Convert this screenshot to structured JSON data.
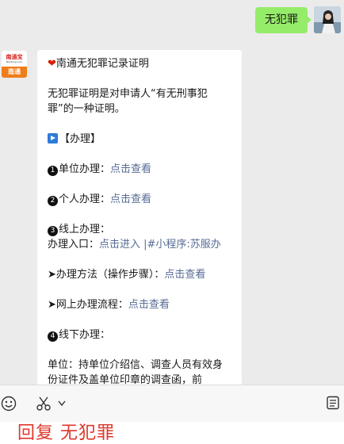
{
  "outgoing": {
    "text": "无犯罪"
  },
  "incoming": {
    "avatar": {
      "logo_text": "南通宝",
      "logo_sub": "Nantong.com",
      "tag": "南通"
    },
    "title_icon": "❤",
    "title": "南通无犯罪记录证明",
    "intro": "无犯罪证明是对申请人“有无刑事犯罪”的一种证明。",
    "handle_label": "【办理】",
    "items": {
      "unit": {
        "num": "1",
        "label": "单位办理：",
        "link": "点击查看"
      },
      "personal": {
        "num": "2",
        "label": "个人办理：",
        "link": "点击查看"
      },
      "online": {
        "num": "3",
        "label": "线上办理：",
        "entry_label": "办理入口：",
        "entry_link": "点击进入 |#小程序:苏服办"
      },
      "method": {
        "arrow": "➤",
        "label": "办理方法（操作步骤）：",
        "link": "点击查看"
      },
      "process": {
        "arrow": "➤",
        "label": "网上办理流程：",
        "link": "点击查看"
      },
      "offline": {
        "num": "4",
        "label": "线下办理："
      }
    },
    "unit_text": "单位：持单位介绍信、调查人员有效身份证件及盖单位印章的调查函，前"
  },
  "toolbar": {
    "emoji_icon": "emoji-icon",
    "scissors_icon": "scissors-icon",
    "chevron_icon": "chevron-down-icon",
    "menu_icon": "menu-icon"
  },
  "reply_prompt": "回复 无犯罪"
}
